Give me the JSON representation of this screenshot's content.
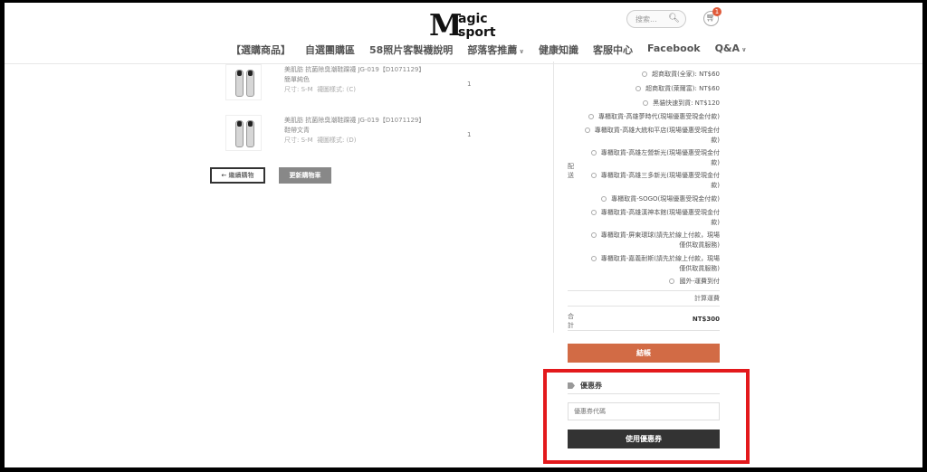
{
  "header": {
    "logo_line1": "agic",
    "logo_line2": "sport",
    "logo_m": "M",
    "search_placeholder": "搜索...",
    "cart_count": "1"
  },
  "nav": {
    "items": [
      {
        "label": "【選購商品】",
        "has_dropdown": false
      },
      {
        "label": "自選團購區",
        "has_dropdown": false
      },
      {
        "label": "58照片客製襪說明",
        "has_dropdown": false
      },
      {
        "label": "部落客推薦",
        "has_dropdown": true
      },
      {
        "label": "健康知識",
        "has_dropdown": false
      },
      {
        "label": "客服中心",
        "has_dropdown": false
      },
      {
        "label": "Facebook",
        "has_dropdown": false
      },
      {
        "label": "Q&A",
        "has_dropdown": true
      }
    ]
  },
  "cart": {
    "items": [
      {
        "name": "美肌肪 抗菌除臭潮鞋踝襪 JG-019【D1071129】",
        "variant": "簡單純色",
        "size_label": "尺寸:",
        "size": "S-M",
        "style_label": "襪圖樣式:",
        "style": "(C)",
        "qty": "1"
      },
      {
        "name": "美肌肪 抗菌除臭潮鞋踝襪 JG-019【D1071129】",
        "variant": "鞋帶文青",
        "size_label": "尺寸:",
        "size": "S-M",
        "style_label": "襪圖樣式:",
        "style": "(D)",
        "qty": "1"
      }
    ],
    "continue_label": "← 繼續購物",
    "update_label": "更新購物車"
  },
  "totals": {
    "shipping_label": "配送",
    "shipping_options": [
      {
        "lines": [
          "超商取貨(全家): NT$60"
        ]
      },
      {
        "lines": [
          "超商取貨(萊爾富): NT$60"
        ]
      },
      {
        "lines": [
          "黑貓快速到貨: NT$120"
        ]
      },
      {
        "lines": [
          "專櫃取貨-高雄夢時代(現場優惠受現金付款)"
        ]
      },
      {
        "lines": [
          "專櫃取貨-高雄大統和平店(現場優惠受現金付",
          "款)"
        ]
      },
      {
        "lines": [
          "專櫃取貨-高雄左營新光(現場優惠受現金付",
          "款)"
        ]
      },
      {
        "lines": [
          "專櫃取貨-高雄三多新光(現場優惠受現金付",
          "款)"
        ]
      },
      {
        "lines": [
          "專櫃取貨-SOGO(現場優惠受現金付款)"
        ]
      },
      {
        "lines": [
          "專櫃取貨-高雄漢神本館(現場優惠受現金付",
          "款)"
        ]
      },
      {
        "lines": [
          "專櫃取貨-屏東環球(請先於線上付款，現場",
          "僅供取貨服務)"
        ]
      },
      {
        "lines": [
          "專櫃取貨-嘉義耐斯(請先於線上付款，現場",
          "僅供取貨服務)"
        ]
      },
      {
        "lines": [
          "國外-運費到付"
        ]
      }
    ],
    "calc_shipping": "計算運費",
    "total_label": "合計",
    "total_value": "NT$300",
    "checkout_label": "結帳"
  },
  "coupon": {
    "title": "優惠券",
    "placeholder": "優惠券代碼",
    "apply_label": "使用優惠券"
  }
}
